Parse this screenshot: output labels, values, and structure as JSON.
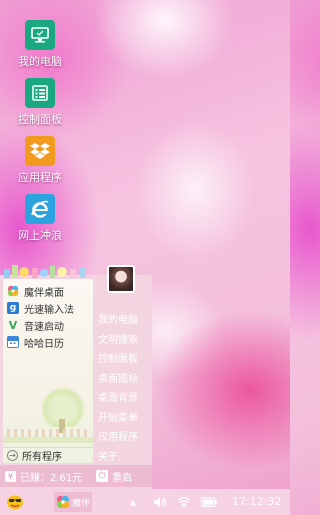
{
  "desktop": {
    "icons": [
      {
        "label": "我的电脑",
        "icon": "monitor-icon",
        "color": "#1aa880"
      },
      {
        "label": "控制面板",
        "icon": "list-icon",
        "color": "#1aa880"
      },
      {
        "label": "应用程序",
        "icon": "dropbox-icon",
        "color": "#f29a1d"
      },
      {
        "label": "网上冲浪",
        "icon": "ie-icon",
        "color": "#2aa3df"
      }
    ]
  },
  "start_menu": {
    "apps": [
      {
        "label": "魔伴桌面",
        "icon": "pinwheel-icon"
      },
      {
        "label": "光速输入法",
        "icon": "g-keyboard-icon"
      },
      {
        "label": "音速启动",
        "icon": "v-launch-icon"
      },
      {
        "label": "哈哈日历",
        "icon": "calendar-icon"
      }
    ],
    "all_programs": "所有程序",
    "links": [
      "我的电脑",
      "文明搜索",
      "控制面板",
      "桌面图标",
      "桌面背景",
      "开始菜单",
      "应用程序",
      "关于.."
    ],
    "earned": "已赚：2.61元",
    "restart": "重启"
  },
  "taskbar": {
    "app_label": "魔伴",
    "clock": "17:12:32"
  },
  "colors": {
    "menu_bg": "#f3d5e1",
    "menu_footer": "#eebcd0",
    "taskbar_bg": "#f6d3e4"
  }
}
